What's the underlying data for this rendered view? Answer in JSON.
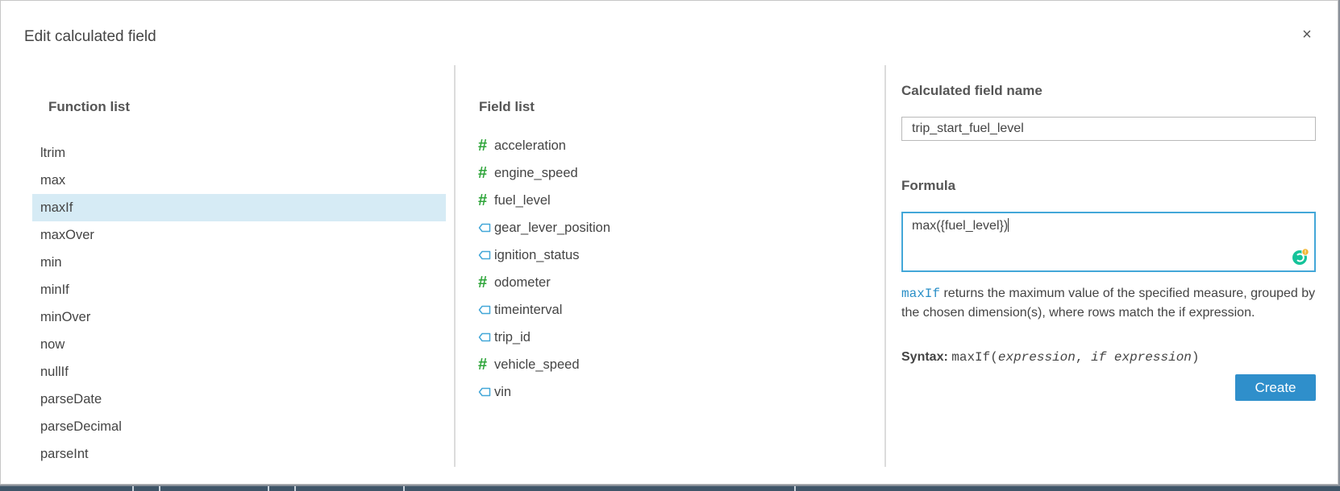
{
  "dialog": {
    "title": "Edit calculated field",
    "close_label": "×"
  },
  "function_panel": {
    "heading": "Function list",
    "items": [
      {
        "label": "ltrim",
        "selected": false
      },
      {
        "label": "max",
        "selected": false
      },
      {
        "label": "maxIf",
        "selected": true
      },
      {
        "label": "maxOver",
        "selected": false
      },
      {
        "label": "min",
        "selected": false
      },
      {
        "label": "minIf",
        "selected": false
      },
      {
        "label": "minOver",
        "selected": false
      },
      {
        "label": "now",
        "selected": false
      },
      {
        "label": "nullIf",
        "selected": false
      },
      {
        "label": "parseDate",
        "selected": false
      },
      {
        "label": "parseDecimal",
        "selected": false
      },
      {
        "label": "parseInt",
        "selected": false
      }
    ]
  },
  "field_panel": {
    "heading": "Field list",
    "items": [
      {
        "label": "acceleration",
        "icon": "hash-icon"
      },
      {
        "label": "engine_speed",
        "icon": "hash-icon"
      },
      {
        "label": "fuel_level",
        "icon": "hash-icon"
      },
      {
        "label": "gear_lever_position",
        "icon": "tag-icon"
      },
      {
        "label": "ignition_status",
        "icon": "tag-icon"
      },
      {
        "label": "odometer",
        "icon": "hash-icon"
      },
      {
        "label": "timeinterval",
        "icon": "tag-icon"
      },
      {
        "label": "trip_id",
        "icon": "tag-icon"
      },
      {
        "label": "vehicle_speed",
        "icon": "hash-icon"
      },
      {
        "label": "vin",
        "icon": "tag-icon"
      }
    ]
  },
  "editor": {
    "name_heading": "Calculated field name",
    "name_value": "trip_start_fuel_level",
    "formula_heading": "Formula",
    "formula_value": "max({fuel_level})",
    "description_fn": "maxIf",
    "description_text": " returns the maximum value of the specified measure, grouped by the chosen dimension(s), where rows match the if expression.",
    "syntax_label": "Syntax:",
    "syntax_fn": "maxIf(",
    "syntax_arg1": "expression",
    "syntax_sep": ", ",
    "syntax_arg2": "if expression",
    "syntax_close": ")",
    "create_label": "Create"
  },
  "colors": {
    "accent": "#2f8fcb",
    "selected_row": "#d6ebf5",
    "measure_icon": "#2ea53a",
    "dimension_icon": "#43a7d8"
  }
}
